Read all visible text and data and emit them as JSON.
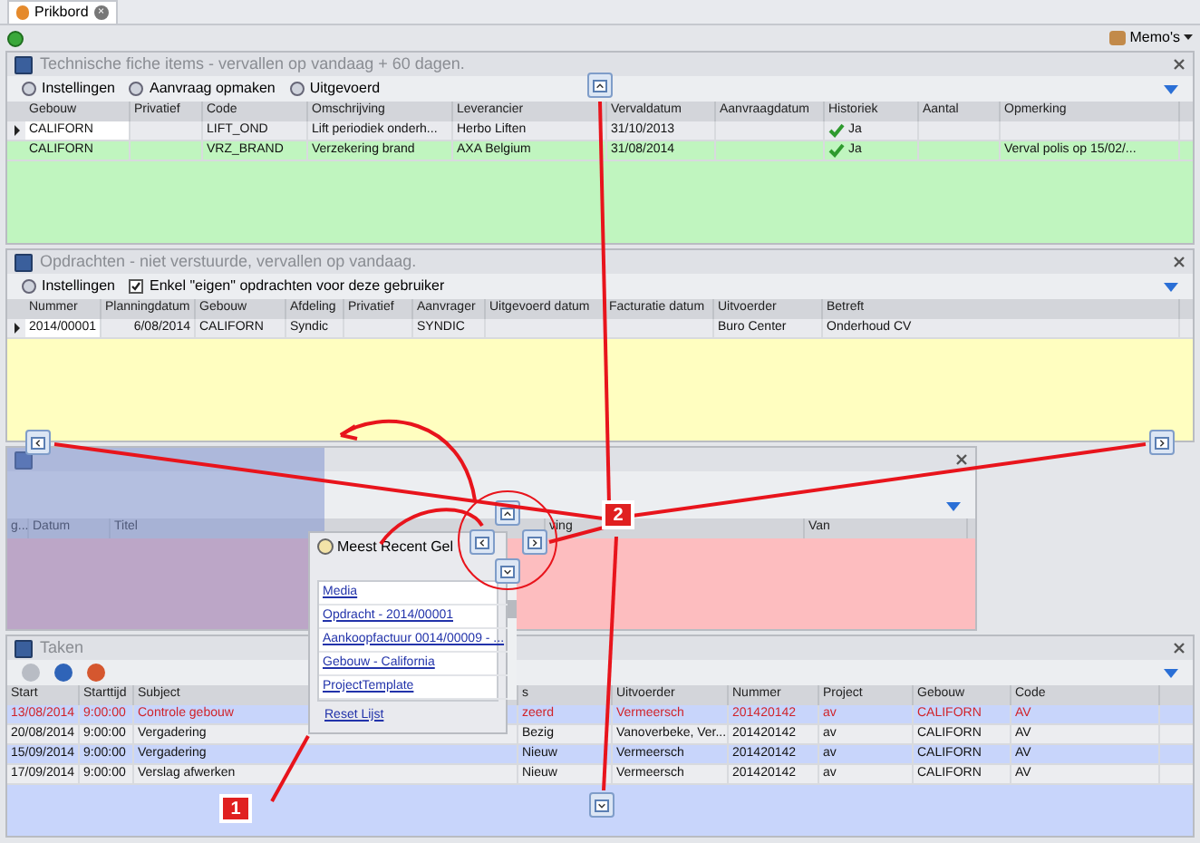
{
  "tab": {
    "label": "Prikbord",
    "close": "×"
  },
  "top_toolbar": {
    "memos_button": "Memo's"
  },
  "panels": [
    {
      "title": "Technische fiche items - vervallen op vandaag + 60 dagen.",
      "color": "#c0f5bf",
      "toolbar": [
        {
          "kind": "button",
          "label": "Instellingen"
        },
        {
          "kind": "button",
          "label": "Aanvraag opmaken"
        },
        {
          "kind": "button",
          "label": "Uitgevoerd"
        }
      ],
      "columns": [
        "Gebouw",
        "Privatief",
        "Code",
        "Omschrijving",
        "Leverancier",
        "Vervaldatum",
        "Aanvraagdatum",
        "Historiek",
        "Aantal",
        "Opmerking"
      ],
      "rows": [
        {
          "selected": true,
          "cells": [
            "CALIFORN",
            "",
            "LIFT_OND",
            "Lift periodiek onderh...",
            "Herbo Liften",
            "31/10/2013",
            "",
            {
              "text": "Ja",
              "checked": true
            },
            "",
            ""
          ]
        },
        {
          "selected": false,
          "cells": [
            "CALIFORN",
            "",
            "VRZ_BRAND",
            "Verzekering brand",
            "AXA Belgium",
            "31/08/2014",
            "",
            {
              "text": "Ja",
              "checked": true
            },
            "",
            "Verval polis op 15/02/..."
          ]
        }
      ]
    },
    {
      "title": "Opdrachten - niet verstuurde, vervallen op vandaag.",
      "color": "#fffec0",
      "toolbar": [
        {
          "kind": "button",
          "label": "Instellingen"
        },
        {
          "kind": "checkbox",
          "label": "Enkel \"eigen\" opdrachten voor deze gebruiker",
          "checked": true
        }
      ],
      "columns": [
        "Nummer",
        "Planningdatum",
        "Gebouw",
        "Afdeling",
        "Privatief",
        "Aanvrager",
        "Uitgevoerd datum",
        "Facturatie datum",
        "Uitvoerder",
        "Betreft"
      ],
      "rows": [
        {
          "selected": true,
          "cells": [
            "2014/00001",
            "6/08/2014",
            "CALIFORN",
            "Syndic",
            "",
            "SYNDIC",
            "",
            "",
            "Buro Center",
            "Onderhoud CV"
          ]
        }
      ]
    },
    {
      "color": "#fdbdbf",
      "columns": [
        "g...",
        "Datum",
        "Titel",
        "ving",
        "Van"
      ]
    },
    {
      "title": "Taken",
      "color": "#c8d5fb",
      "toolbar": [
        {
          "kind": "icon"
        },
        {
          "kind": "icon"
        },
        {
          "kind": "icon"
        }
      ],
      "columns": [
        "Start",
        "Starttijd",
        "Subject",
        "s",
        "Uitvoerder",
        "Nummer",
        "Project",
        "Gebouw",
        "Code"
      ],
      "rows": [
        {
          "selected": false,
          "overdue": true,
          "cells": [
            "13/08/2014",
            "9:00:00",
            "Controle gebouw",
            "zeerd",
            "Vermeersch",
            "201420142",
            "av",
            "CALIFORN",
            "AV"
          ]
        },
        {
          "selected": false,
          "overdue": false,
          "cells": [
            "20/08/2014",
            "9:00:00",
            "Vergadering",
            "Bezig",
            "Vanoverbeke, Ver...",
            "201420142",
            "av",
            "CALIFORN",
            "AV"
          ]
        },
        {
          "selected": false,
          "overdue": false,
          "cells": [
            "15/09/2014",
            "9:00:00",
            "Vergadering",
            "Nieuw",
            "Vermeersch",
            "201420142",
            "av",
            "CALIFORN",
            "AV"
          ]
        },
        {
          "selected": false,
          "overdue": false,
          "cells": [
            "17/09/2014",
            "9:00:00",
            "Verslag afwerken",
            "Nieuw",
            "Vermeersch",
            "201420142",
            "av",
            "CALIFORN",
            "AV"
          ]
        }
      ]
    }
  ],
  "recent_popup": {
    "title": "Meest Recent Gel",
    "items": [
      "Media",
      "Opdracht - 2014/00001",
      "Aankoopfactuur 0014/00009 - ...",
      "Gebouw - California",
      "ProjectTemplate"
    ],
    "reset": "Reset Lijst"
  },
  "callouts": [
    "1",
    "2"
  ]
}
